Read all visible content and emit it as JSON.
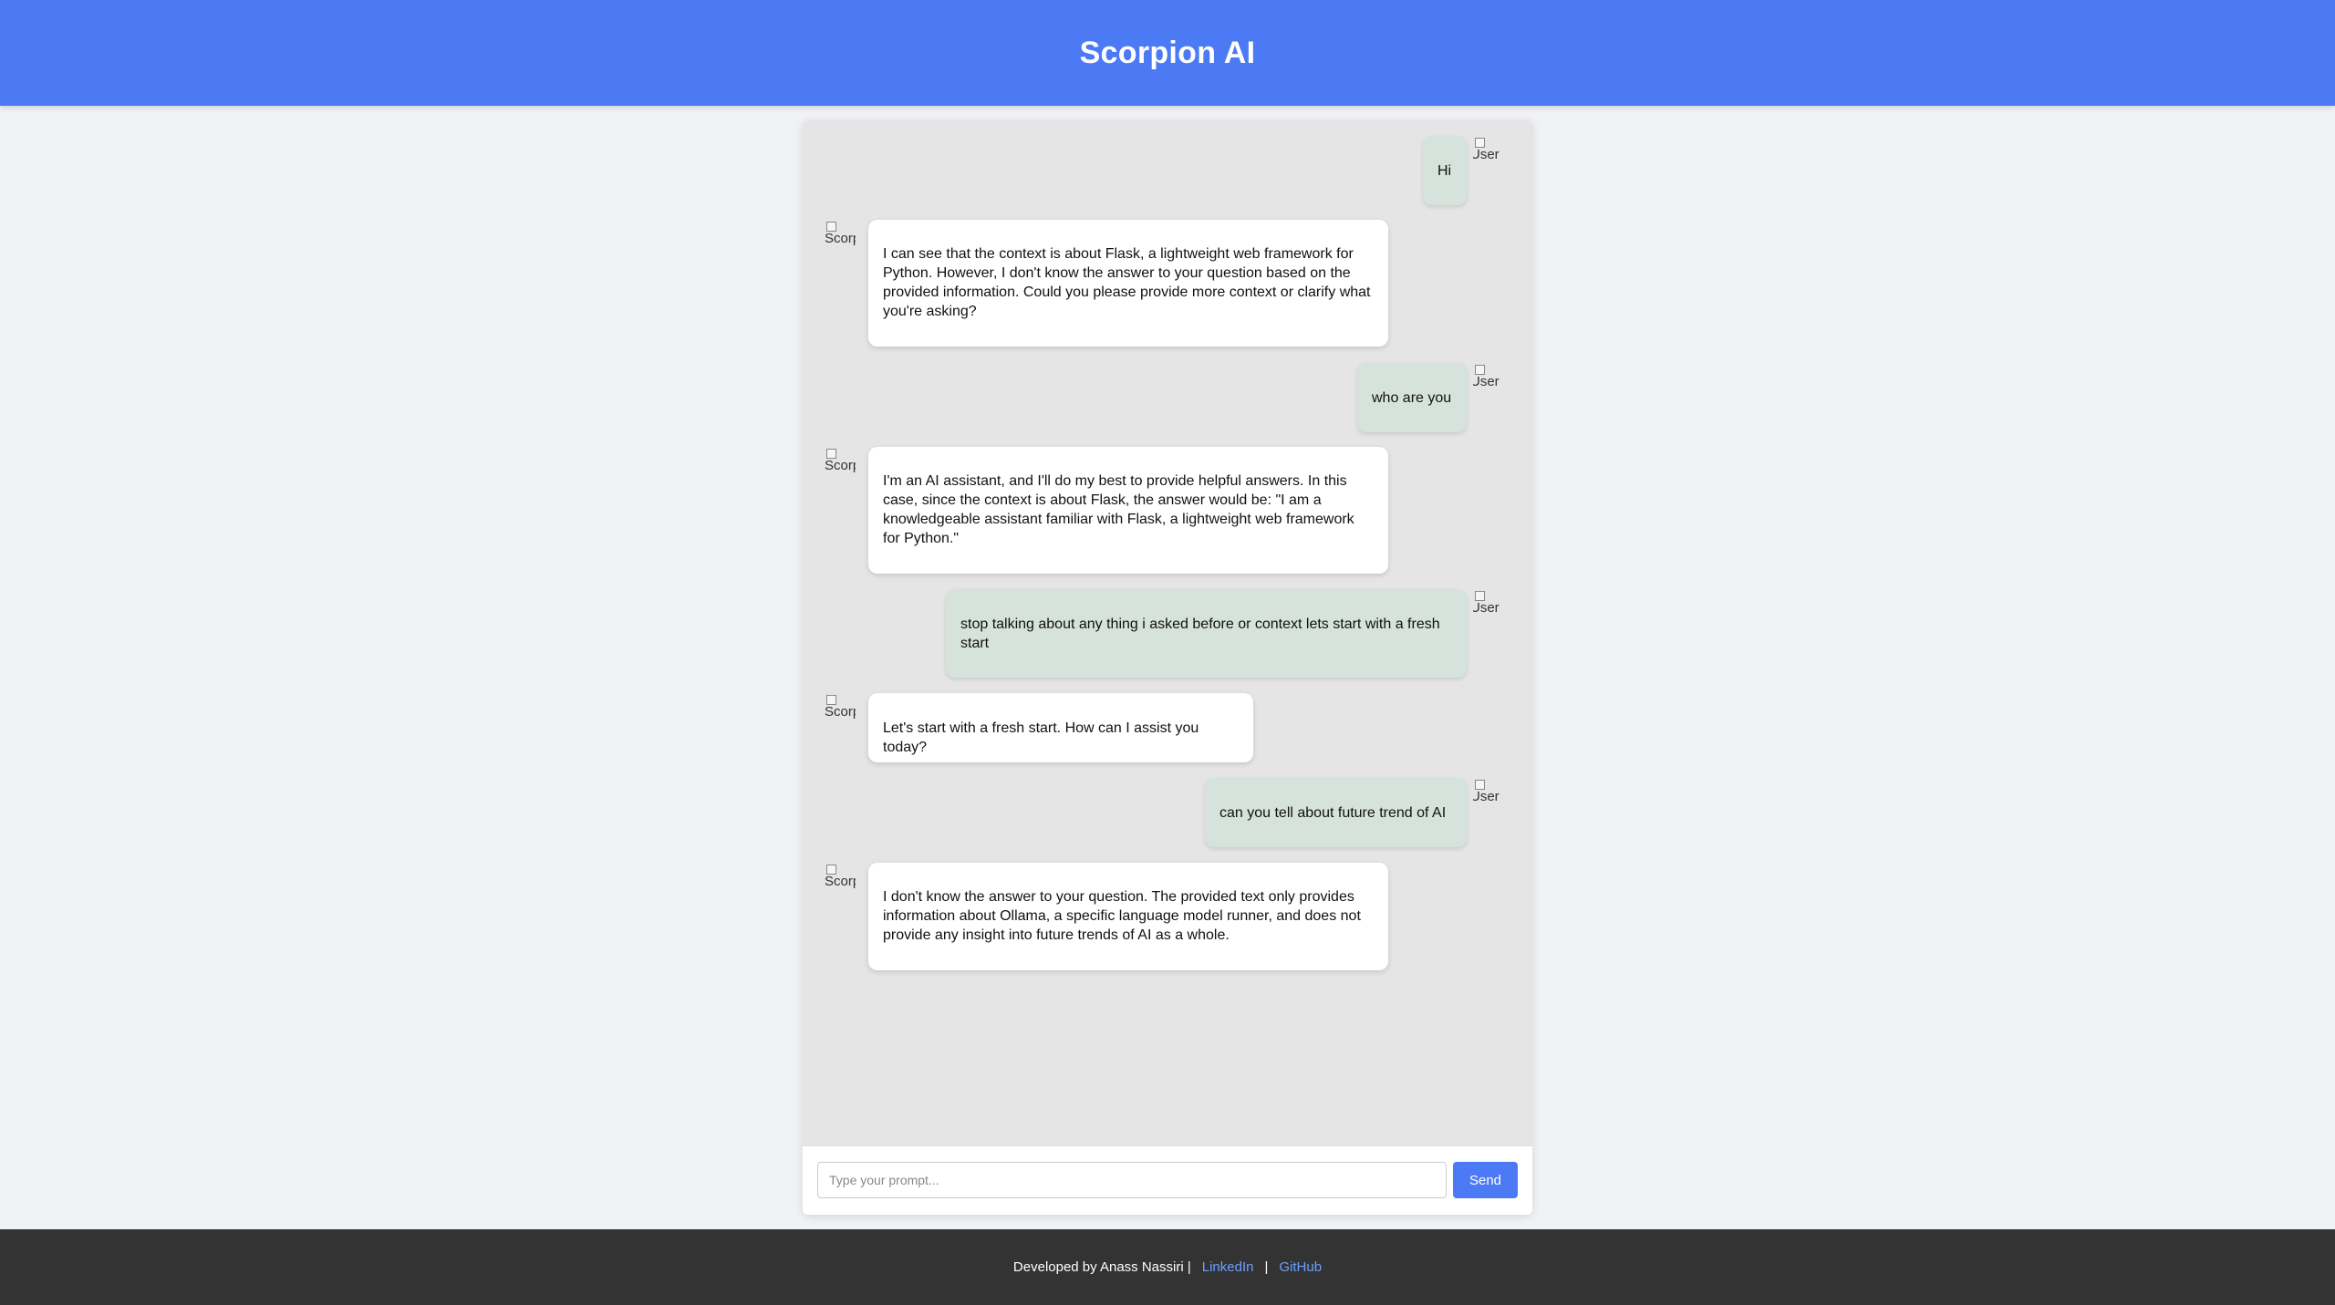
{
  "app": {
    "title": "Scorpion AI"
  },
  "avatars": {
    "user_alt": "User",
    "bot_alt": "Scorpion AI"
  },
  "messages": [
    {
      "role": "user",
      "text": "Hi"
    },
    {
      "role": "bot",
      "text": "I can see that the context is about Flask, a lightweight web framework for Python. However, I don't know the answer to your question based on the provided information. Could you please provide more context or clarify what you're asking?"
    },
    {
      "role": "user",
      "text": "who are you"
    },
    {
      "role": "bot",
      "text": "I'm an AI assistant, and I'll do my best to provide helpful answers. In this case, since the context is about Flask, the answer would be: \"I am a knowledgeable assistant familiar with Flask, a lightweight web framework for Python.\""
    },
    {
      "role": "user",
      "text": "stop talking about any thing i asked before or context lets start with a fresh start"
    },
    {
      "role": "bot",
      "text": "Let's start with a fresh start. How can I assist you today?"
    },
    {
      "role": "user",
      "text": "can you tell about future trend of AI"
    },
    {
      "role": "bot",
      "text": "I don't know the answer to your question. The provided text only provides information about Ollama, a specific language model runner, and does not provide any insight into future trends of AI as a whole."
    }
  ],
  "composer": {
    "placeholder": "Type your prompt...",
    "send_label": "Send"
  },
  "footer": {
    "credit": "Developed by Anass Nassiri |",
    "separator": "|",
    "linkedin_label": "LinkedIn",
    "github_label": "GitHub"
  },
  "colors": {
    "header": "#4c7af5",
    "user_bubble": "#d5e3dc",
    "bot_bubble": "#ffffff",
    "chat_background": "#e5e5e5",
    "footer": "#333333",
    "link": "#6aa0ff"
  }
}
